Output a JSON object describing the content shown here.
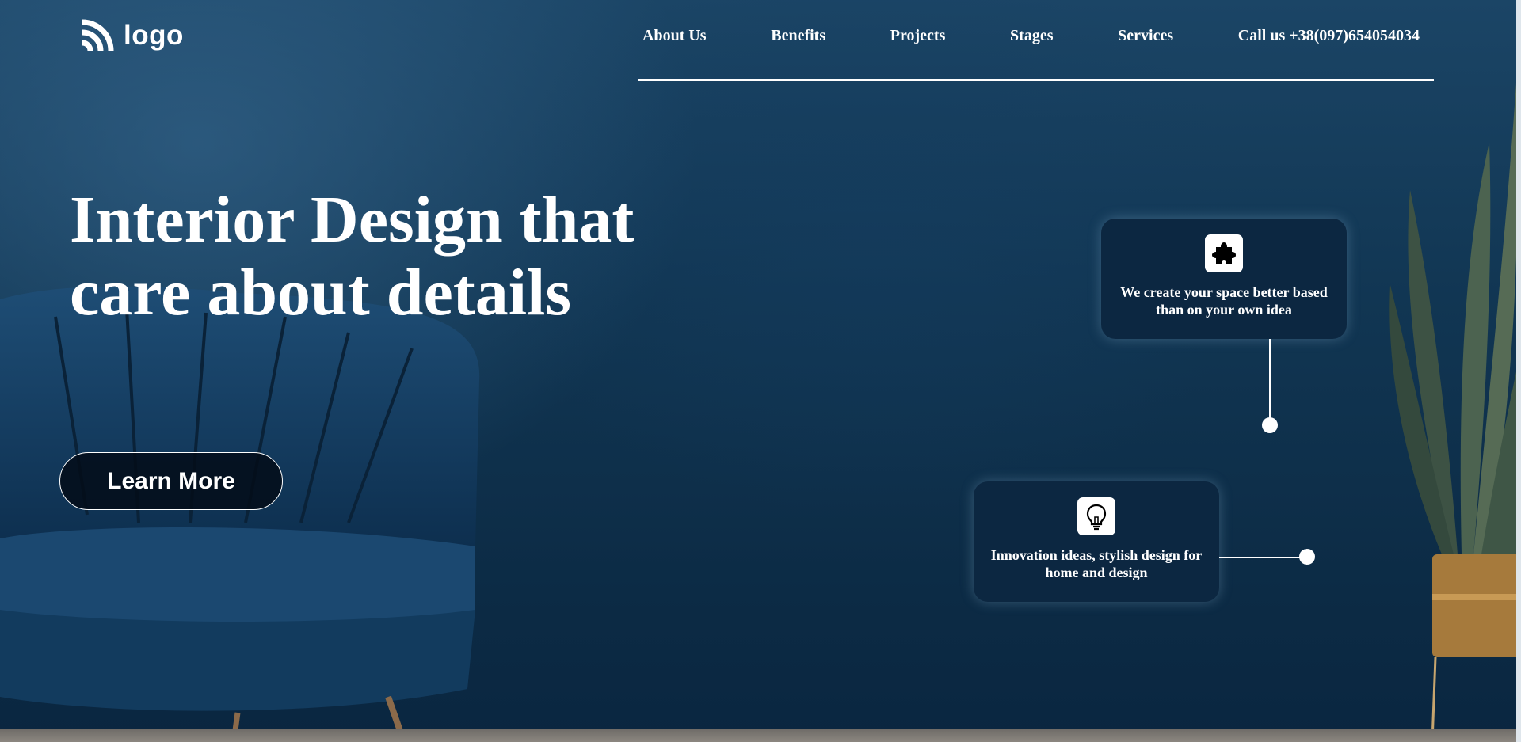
{
  "header": {
    "logo_text": "logo",
    "nav": [
      "About Us",
      "Benefits",
      "Projects",
      "Stages",
      "Services",
      "Call us +38(097)654054034"
    ]
  },
  "hero": {
    "title": "Interior Design that care about details",
    "cta_label": "Learn More"
  },
  "cards": [
    {
      "icon": "puzzle-icon",
      "text": "We create your space better based than on your own idea"
    },
    {
      "icon": "lightbulb-icon",
      "text": "Innovation ideas, stylish design for home and design"
    }
  ],
  "colors": {
    "background": "#0e2c46",
    "card": "#0c2741",
    "text": "#ffffff"
  }
}
